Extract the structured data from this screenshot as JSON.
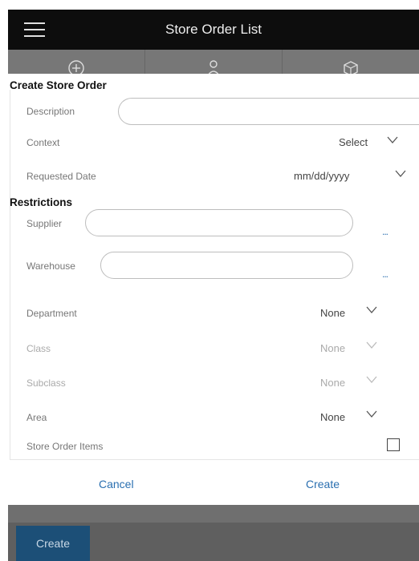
{
  "header": {
    "title": "Store Order List"
  },
  "dialog": {
    "section_create": "Create Store Order",
    "section_restrictions": "Restrictions",
    "fields": {
      "description": {
        "label": "Description",
        "value": ""
      },
      "context": {
        "label": "Context",
        "value": "Select"
      },
      "requested_date": {
        "label": "Requested Date",
        "value": "mm/dd/yyyy"
      },
      "supplier": {
        "label": "Supplier",
        "value": "",
        "lookup": "..."
      },
      "warehouse": {
        "label": "Warehouse",
        "value": "",
        "lookup": "..."
      },
      "department": {
        "label": "Department",
        "value": "None"
      },
      "class": {
        "label": "Class",
        "value": "None"
      },
      "subclass": {
        "label": "Subclass",
        "value": "None"
      },
      "area": {
        "label": "Area",
        "value": "None"
      },
      "store_order_items": {
        "label": "Store Order Items",
        "checked": false
      }
    },
    "cancel_label": "Cancel",
    "create_label": "Create"
  },
  "background": {
    "create_button_label": "Create"
  },
  "colors": {
    "link": "#2a6fb0",
    "header_bg": "#0d0d0d",
    "primary_button": "#1c4f77"
  }
}
